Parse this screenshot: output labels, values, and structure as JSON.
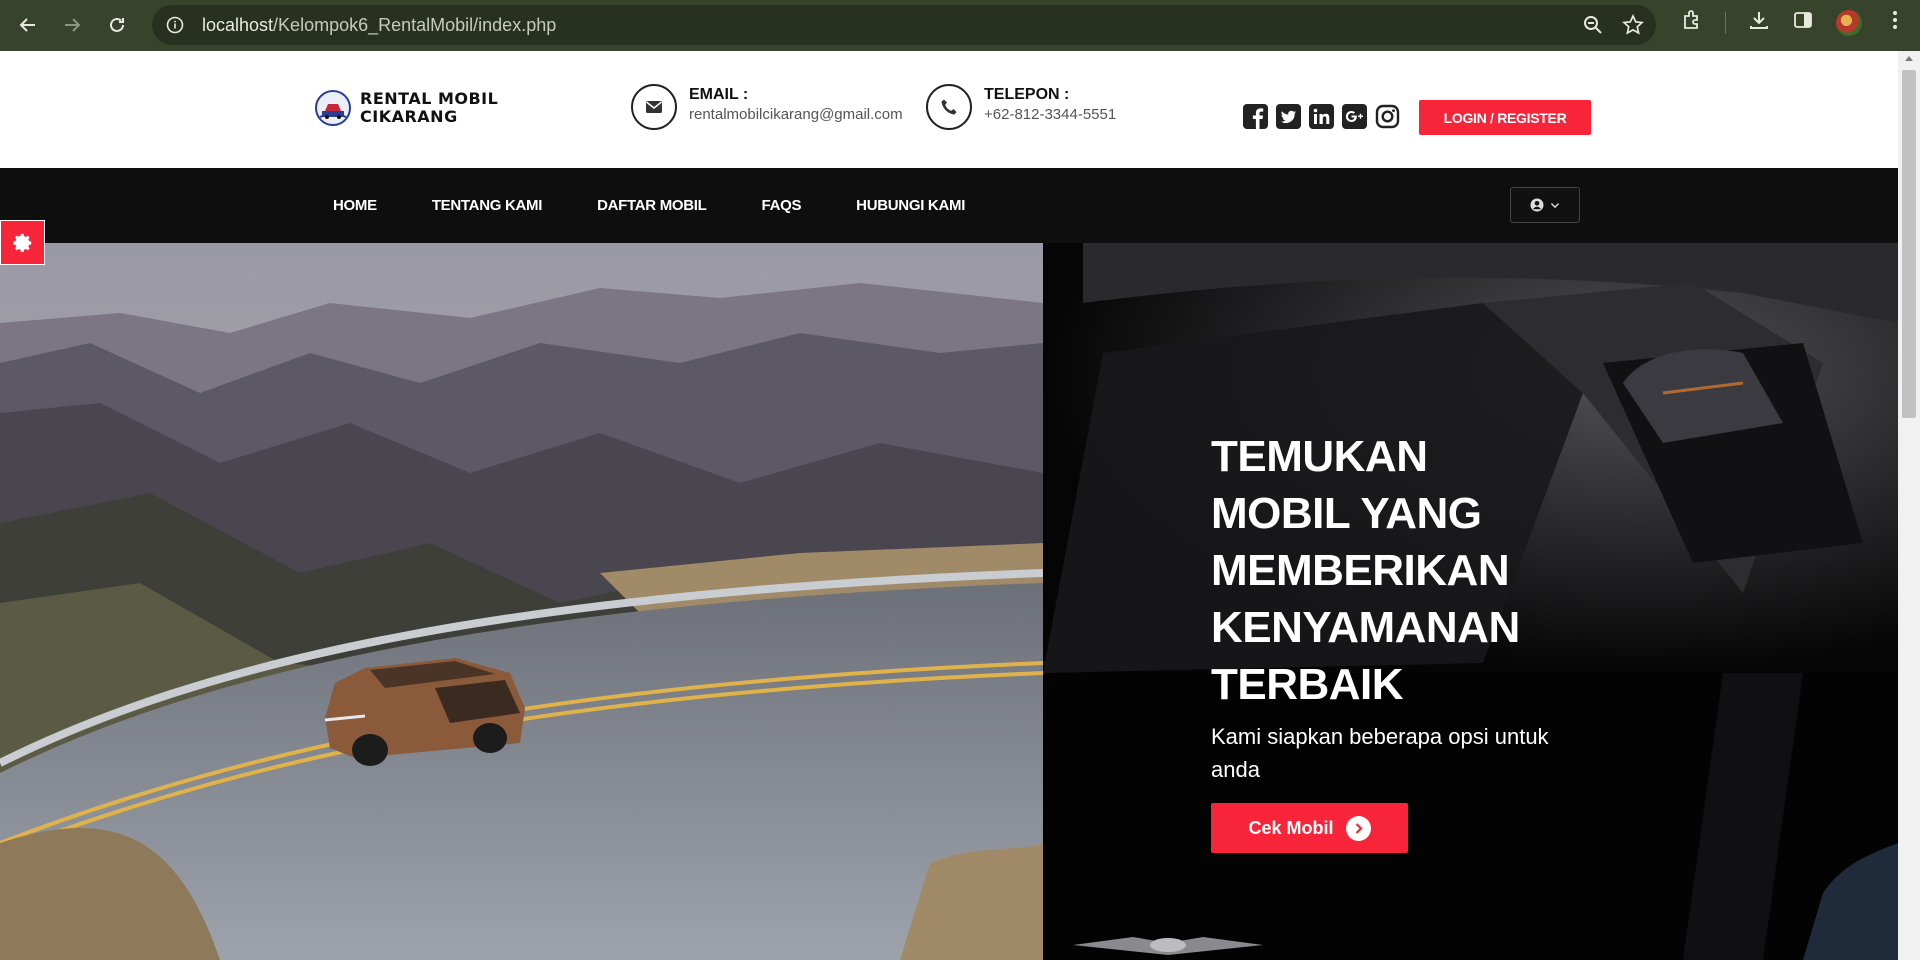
{
  "browser": {
    "url_host": "localhost",
    "url_path": "/Kelompok6_RentalMobil/index.php"
  },
  "header": {
    "logo_line1": "RENTAL MOBIL",
    "logo_line2": "CIKARANG",
    "email_label": "EMAIL :",
    "email_value": "rentalmobilcikarang@gmail.com",
    "phone_label": "TELEPON :",
    "phone_value": "+62-812-3344-5551",
    "socials": [
      "facebook-icon",
      "twitter-icon",
      "linkedin-icon",
      "google-plus-icon",
      "instagram-icon"
    ],
    "login_label": "LOGIN / REGISTER"
  },
  "nav": {
    "items": [
      "HOME",
      "TENTANG KAMI",
      "DAFTAR MOBIL",
      "FAQS",
      "HUBUNGI KAMI"
    ]
  },
  "hero": {
    "title": "TEMUKAN MOBIL YANG MEMBERIKAN KENYAMANAN TERBAIK",
    "subtitle": "Kami siapkan beberapa opsi untuk anda",
    "cta_label": "Cek Mobil"
  },
  "colors": {
    "brand_red": "#f7243a",
    "chrome_bg": "#37432b",
    "nav_bg": "#0e0e0e"
  }
}
